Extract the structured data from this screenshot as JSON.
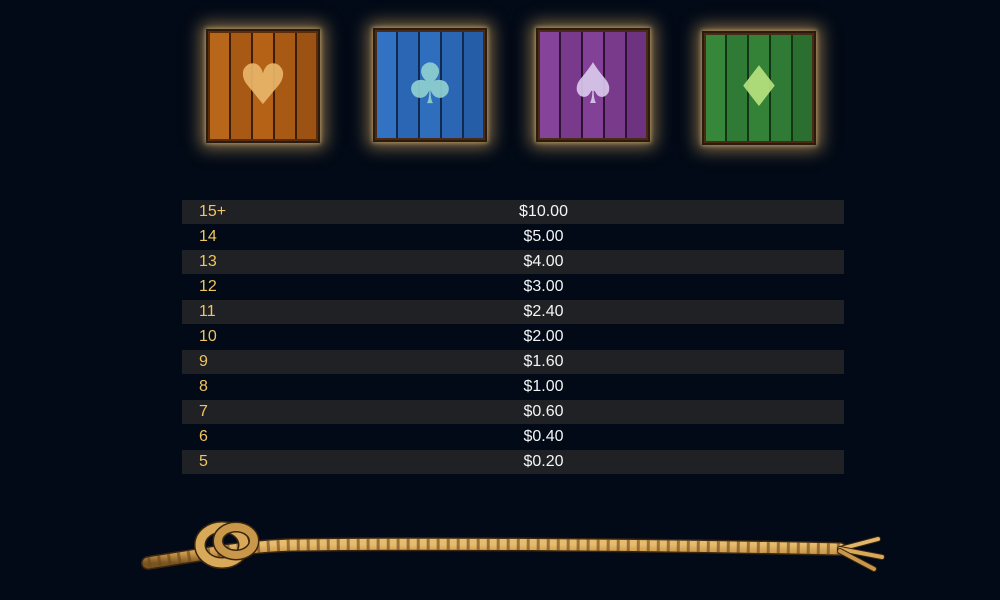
{
  "symbols": [
    {
      "name": "heart",
      "icon": "heart-icon",
      "glyph": "♥",
      "tile_color": "#a85a14",
      "suit_color": "#e8b56a"
    },
    {
      "name": "club",
      "icon": "club-icon",
      "glyph": "♣",
      "tile_color": "#2a66b3",
      "suit_color": "#8fd0d0"
    },
    {
      "name": "spade",
      "icon": "spade-icon",
      "glyph": "♠",
      "tile_color": "#7a3a8c",
      "suit_color": "#d9c8ec"
    },
    {
      "name": "diamond",
      "icon": "diamond-icon",
      "glyph": "♦",
      "tile_color": "#2f7a34",
      "suit_color": "#b7e27e"
    }
  ],
  "paytable": [
    {
      "count": "15+",
      "prize": "$10.00"
    },
    {
      "count": "14",
      "prize": "$5.00"
    },
    {
      "count": "13",
      "prize": "$4.00"
    },
    {
      "count": "12",
      "prize": "$3.00"
    },
    {
      "count": "11",
      "prize": "$2.40"
    },
    {
      "count": "10",
      "prize": "$2.00"
    },
    {
      "count": "9",
      "prize": "$1.60"
    },
    {
      "count": "8",
      "prize": "$1.00"
    },
    {
      "count": "7",
      "prize": "$0.60"
    },
    {
      "count": "6",
      "prize": "$0.40"
    },
    {
      "count": "5",
      "prize": "$0.20"
    }
  ],
  "colors": {
    "background": "#020a17",
    "count_text": "#f0c560",
    "prize_text": "#f4f4f4",
    "row_stripe": "#202124",
    "rope": "#c9974a",
    "tile_glow": "#eebe6e"
  }
}
